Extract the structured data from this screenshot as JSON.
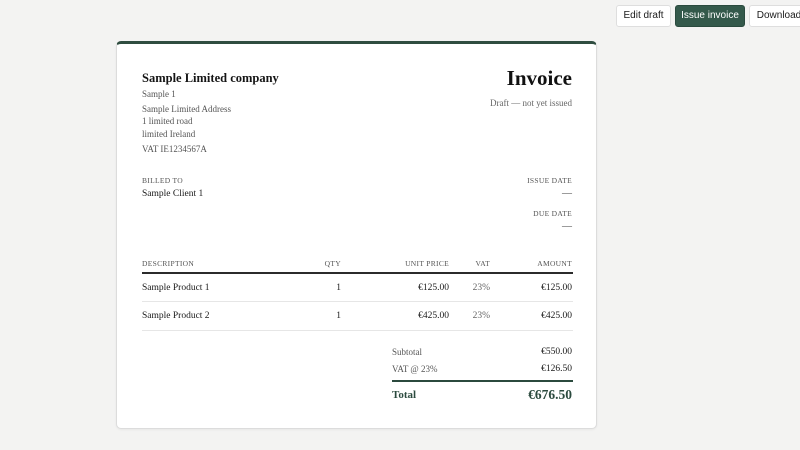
{
  "toolbar": {
    "edit_label": "Edit draft",
    "issue_label": "Issue invoice",
    "download_label": "Download"
  },
  "invoice": {
    "company_name": "Sample Limited company",
    "company_line2": "Sample 1",
    "address_lines": [
      "Sample Limited Address",
      "1 limited road",
      "limited Ireland"
    ],
    "vat_number": "VAT IE1234567A",
    "title": "Invoice",
    "status": "Draft — not yet issued",
    "billed_to_label": "BILLED TO",
    "billed_to": "Sample Client 1",
    "issue_date_label": "ISSUE DATE",
    "issue_date": "—",
    "due_date_label": "DUE DATE",
    "due_date": "—",
    "columns": {
      "description": "DESCRIPTION",
      "qty": "QTY",
      "unit_price": "UNIT PRICE",
      "vat": "VAT",
      "amount": "AMOUNT"
    },
    "line_items": [
      {
        "description": "Sample Product 1",
        "qty": "1",
        "unit_price": "€125.00",
        "vat": "23%",
        "amount": "€125.00"
      },
      {
        "description": "Sample Product 2",
        "qty": "1",
        "unit_price": "€425.00",
        "vat": "23%",
        "amount": "€425.00"
      }
    ],
    "subtotal_label": "Subtotal",
    "subtotal": "€550.00",
    "vat_label": "VAT @ 23%",
    "vat_amount": "€126.50",
    "total_label": "Total",
    "total": "€676.50"
  },
  "colors": {
    "accent": "#34594b",
    "total_text": "#2b4a3e",
    "page_background": "#f3f3f2"
  }
}
